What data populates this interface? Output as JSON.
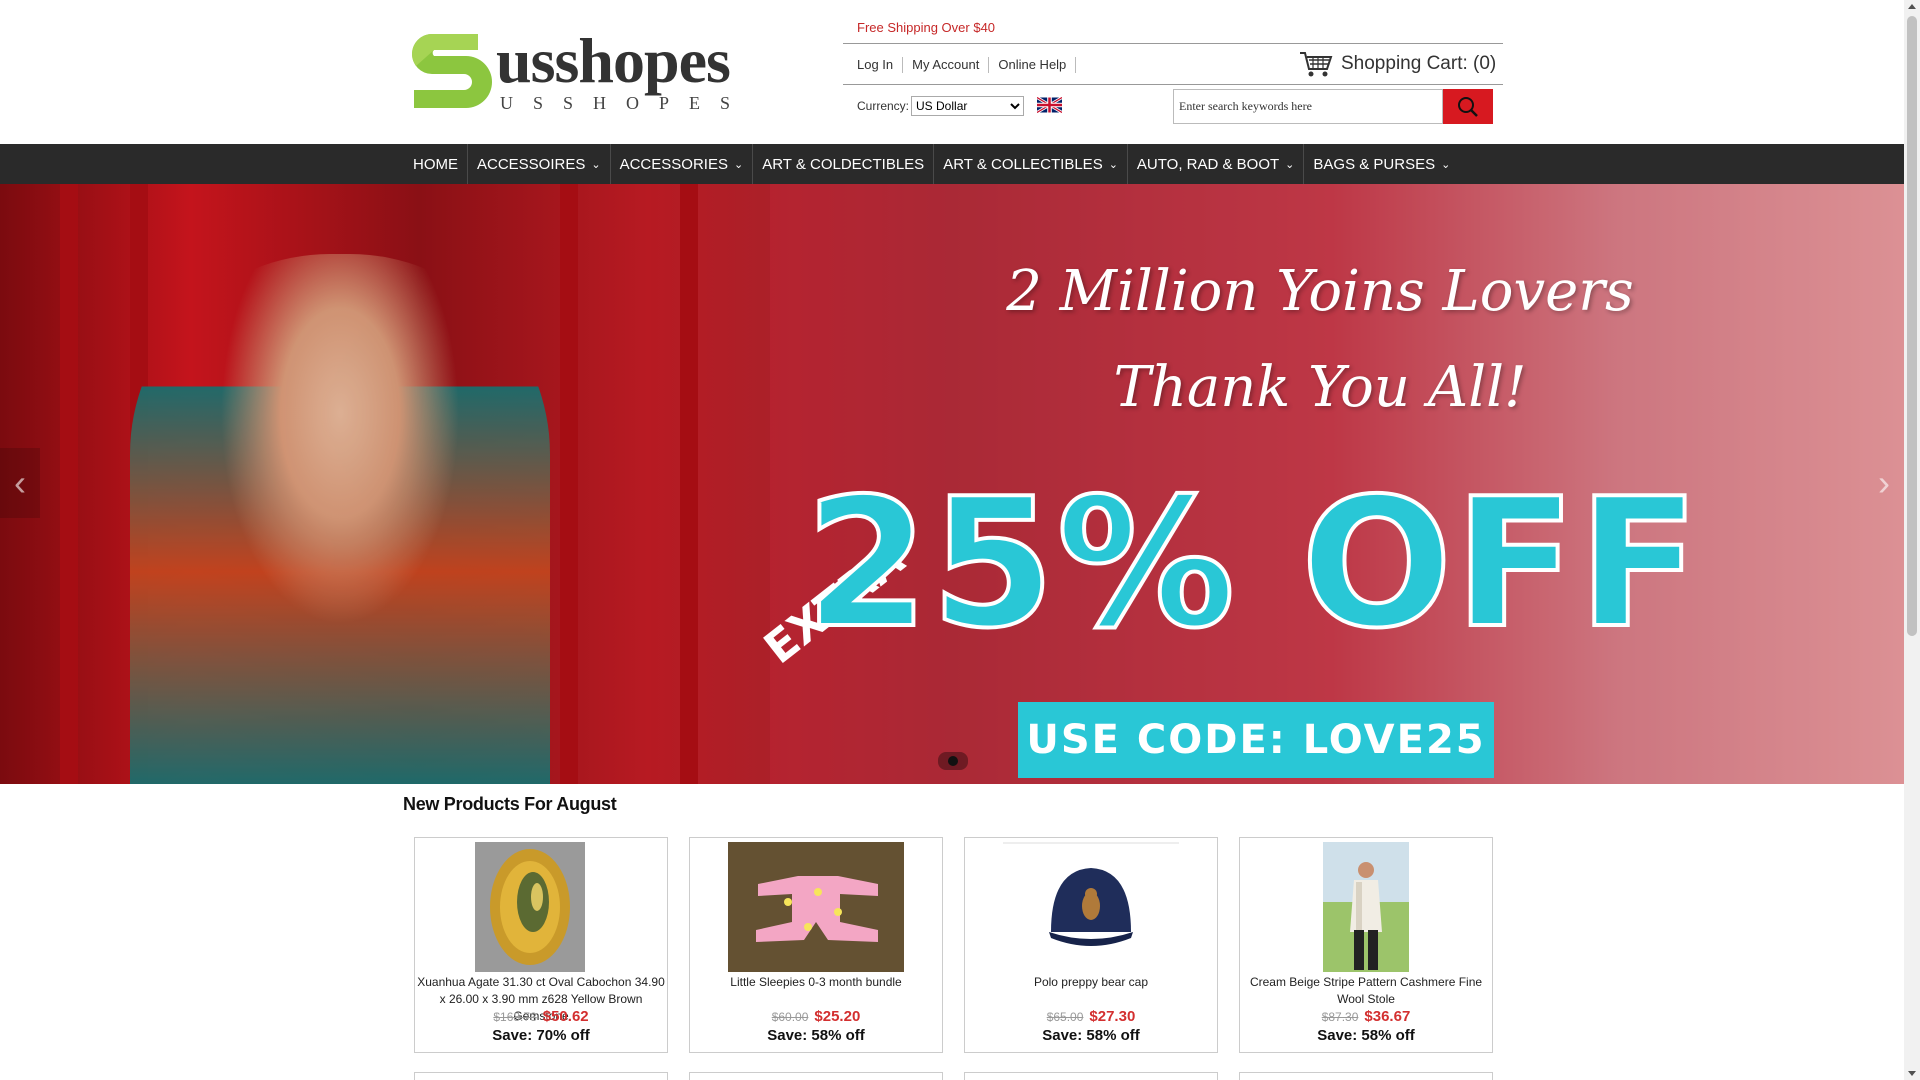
{
  "header": {
    "logo": {
      "main": "usshopes",
      "sub": "USSHOPES"
    },
    "promo": "Free Shipping Over $40",
    "links": [
      "Log In",
      "My Account",
      "Online Help"
    ],
    "cart_label": "Shopping Cart: (0)",
    "currency_label": "Currency:",
    "currency_value": "US Dollar",
    "search_placeholder": "Enter search keywords here"
  },
  "nav": {
    "items": [
      {
        "label": "HOME",
        "dropdown": false
      },
      {
        "label": "ACCESSOIRES",
        "dropdown": true
      },
      {
        "label": "ACCESSORIES",
        "dropdown": true
      },
      {
        "label": "ART & COLDECTIBLES",
        "dropdown": false
      },
      {
        "label": "ART & COLLECTIBLES",
        "dropdown": true
      },
      {
        "label": "AUTO, RAD & BOOT",
        "dropdown": true
      },
      {
        "label": "BAGS & PURSES",
        "dropdown": true
      }
    ]
  },
  "banner": {
    "line1": "2 Million Yoins Lovers",
    "line2": "Thank You All!",
    "extra": "EXTRA",
    "discount": "25% OFF",
    "code": "USE CODE: LOVE25"
  },
  "products": {
    "title": "New Products For August",
    "items": [
      {
        "name": "Xuanhua Agate 31.30 ct Oval Cabochon 34.90 x 26.00 x 3.90 mm z628 Yellow Brown Gemstone",
        "old_price": "$168.73",
        "price": "$50.62",
        "save": "Save: 70% off"
      },
      {
        "name": "Little Sleepies 0-3 month bundle",
        "old_price": "$60.00",
        "price": "$25.20",
        "save": "Save: 58% off"
      },
      {
        "name": "Polo preppy bear cap",
        "old_price": "$65.00",
        "price": "$27.30",
        "save": "Save: 58% off"
      },
      {
        "name": "Cream Beige Stripe Pattern Cashmere Fine Wool Stole",
        "old_price": "$87.30",
        "price": "$36.67",
        "save": "Save: 58% off"
      }
    ]
  },
  "colors": {
    "accent": "#d71920",
    "nav_bg": "#2a2a2a",
    "banner_cyan": "#29c7d6",
    "price_red": "#d32f2f"
  }
}
